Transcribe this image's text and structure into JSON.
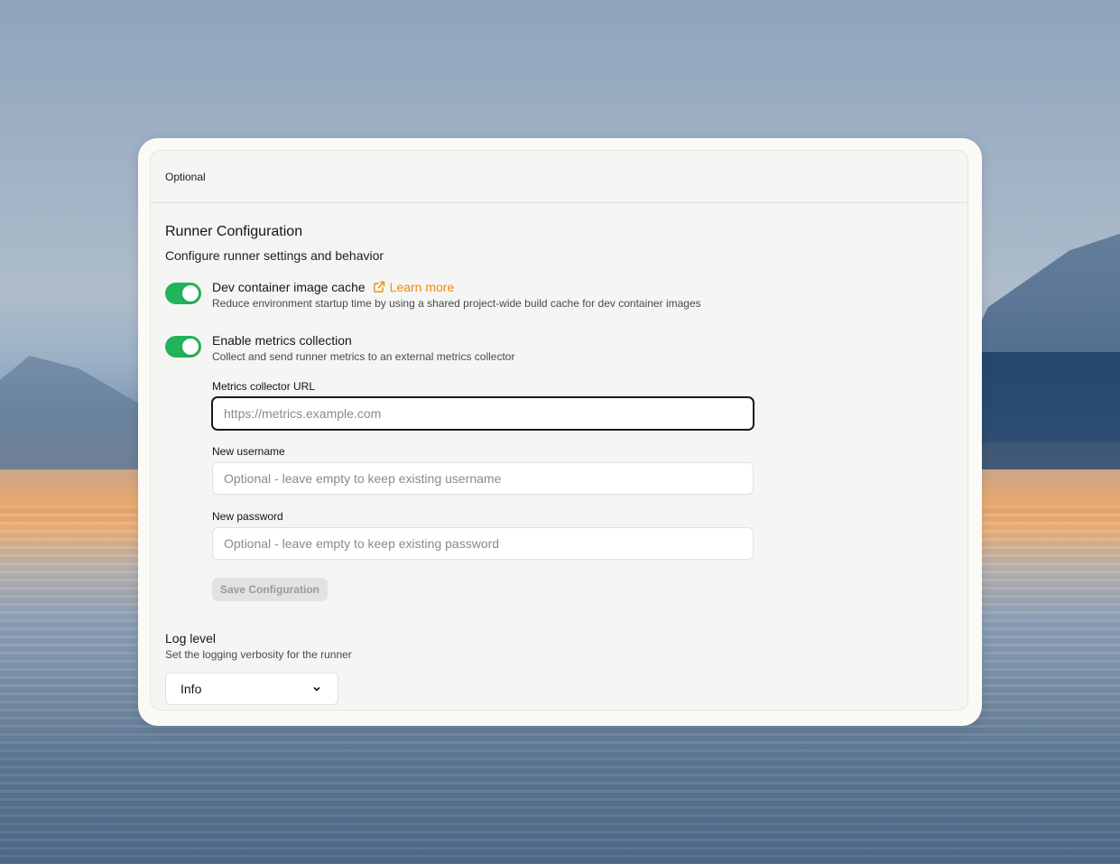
{
  "header": {
    "label": "Optional"
  },
  "runner": {
    "title": "Runner Configuration",
    "subtitle": "Configure runner settings and behavior"
  },
  "dev_cache": {
    "title": "Dev container image cache",
    "learn_more": "Learn more",
    "description": "Reduce environment startup time by using a shared project-wide build cache for dev container images",
    "enabled": true
  },
  "metrics": {
    "title": "Enable metrics collection",
    "description": "Collect and send runner metrics to an external metrics collector",
    "enabled": true,
    "url_label": "Metrics collector URL",
    "url_placeholder": "https://metrics.example.com",
    "username_label": "New username",
    "username_placeholder": "Optional - leave empty to keep existing username",
    "password_label": "New password",
    "password_placeholder": "Optional - leave empty to keep existing password",
    "save_label": "Save Configuration"
  },
  "log_level": {
    "title": "Log level",
    "description": "Set the logging verbosity for the runner",
    "selected": "Info"
  },
  "colors": {
    "toggle_on": "#22b35a",
    "accent_link": "#f08c10"
  }
}
